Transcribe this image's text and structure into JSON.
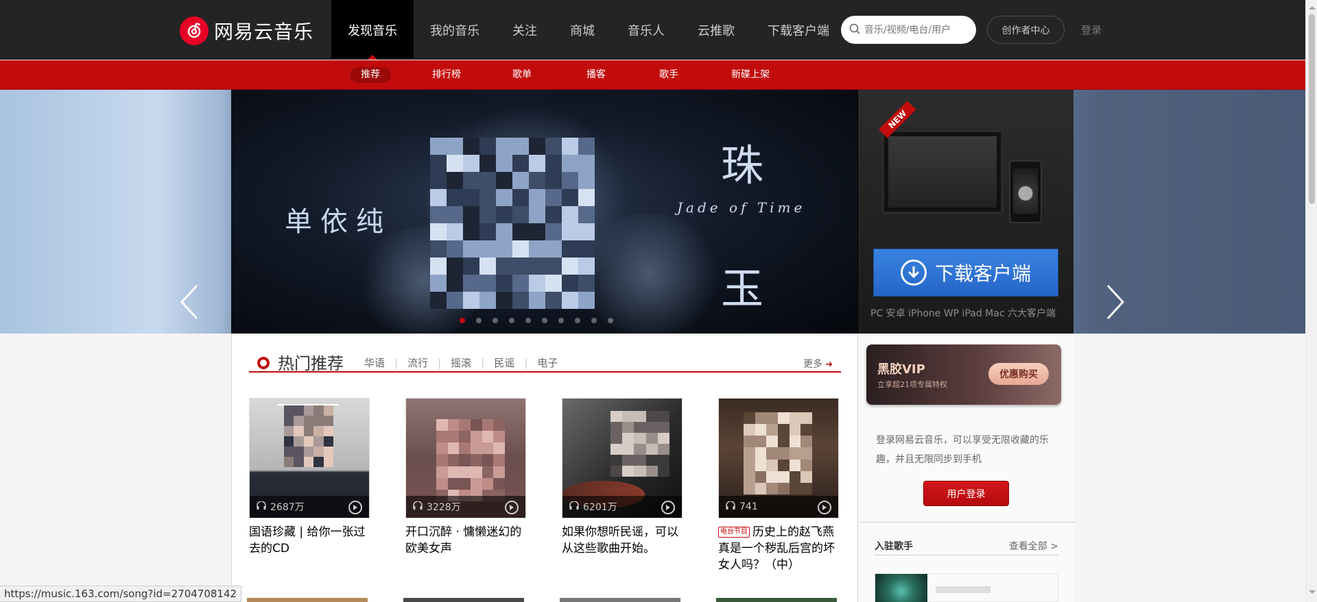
{
  "header": {
    "logo_text": "网易云音乐",
    "nav": [
      "发现音乐",
      "我的音乐",
      "关注",
      "商城",
      "音乐人",
      "云推歌",
      "下载客户端"
    ],
    "search_placeholder": "音乐/视频/电台/用户",
    "creator_center": "创作者中心",
    "login": "登录"
  },
  "subnav": [
    "推荐",
    "排行榜",
    "歌单",
    "播客",
    "歌手",
    "新碟上架"
  ],
  "banner": {
    "singer": "单依纯",
    "title_top": "珠",
    "title_bottom": "玉",
    "subtitle": "Jade of Time",
    "new_tag": "NEW",
    "download_label": "下载客户端",
    "platforms": "PC 安卓 iPhone WP iPad Mac 六大客户端",
    "dot_count": 10,
    "active_dot": 0
  },
  "hot": {
    "title": "热门推荐",
    "tabs": [
      "华语",
      "流行",
      "摇滚",
      "民谣",
      "电子"
    ],
    "more": "更多",
    "cards": [
      {
        "listens": "2687万",
        "title": "国语珍藏 | 给你一张过去的CD",
        "tag": ""
      },
      {
        "listens": "3228万",
        "title": "开口沉醉 · 慵懒迷幻的欧美女声",
        "tag": ""
      },
      {
        "listens": "6201万",
        "title": "如果你想听民谣，可以从这些歌曲开始。",
        "tag": ""
      },
      {
        "listens": "741",
        "title": "历史上的赵飞燕真是一个秽乱后宫的坏女人吗？（中）",
        "tag": "电台节目"
      }
    ]
  },
  "sidebar": {
    "vip_title": "黑胶VIP",
    "vip_sub": "立享超21项专属特权",
    "vip_button": "优惠购买",
    "login_desc": "登录网易云音乐，可以享受无限收藏的乐趣，并且无限同步到手机",
    "login_button": "用户登录",
    "artists_title": "入驻歌手",
    "artists_more": "查看全部 >"
  },
  "status_url": "https://music.163.com/song?id=2704708142",
  "colors": {
    "brand_red": "#c20c0c",
    "topbar": "#242424",
    "download_blue": "#2d74d6"
  }
}
